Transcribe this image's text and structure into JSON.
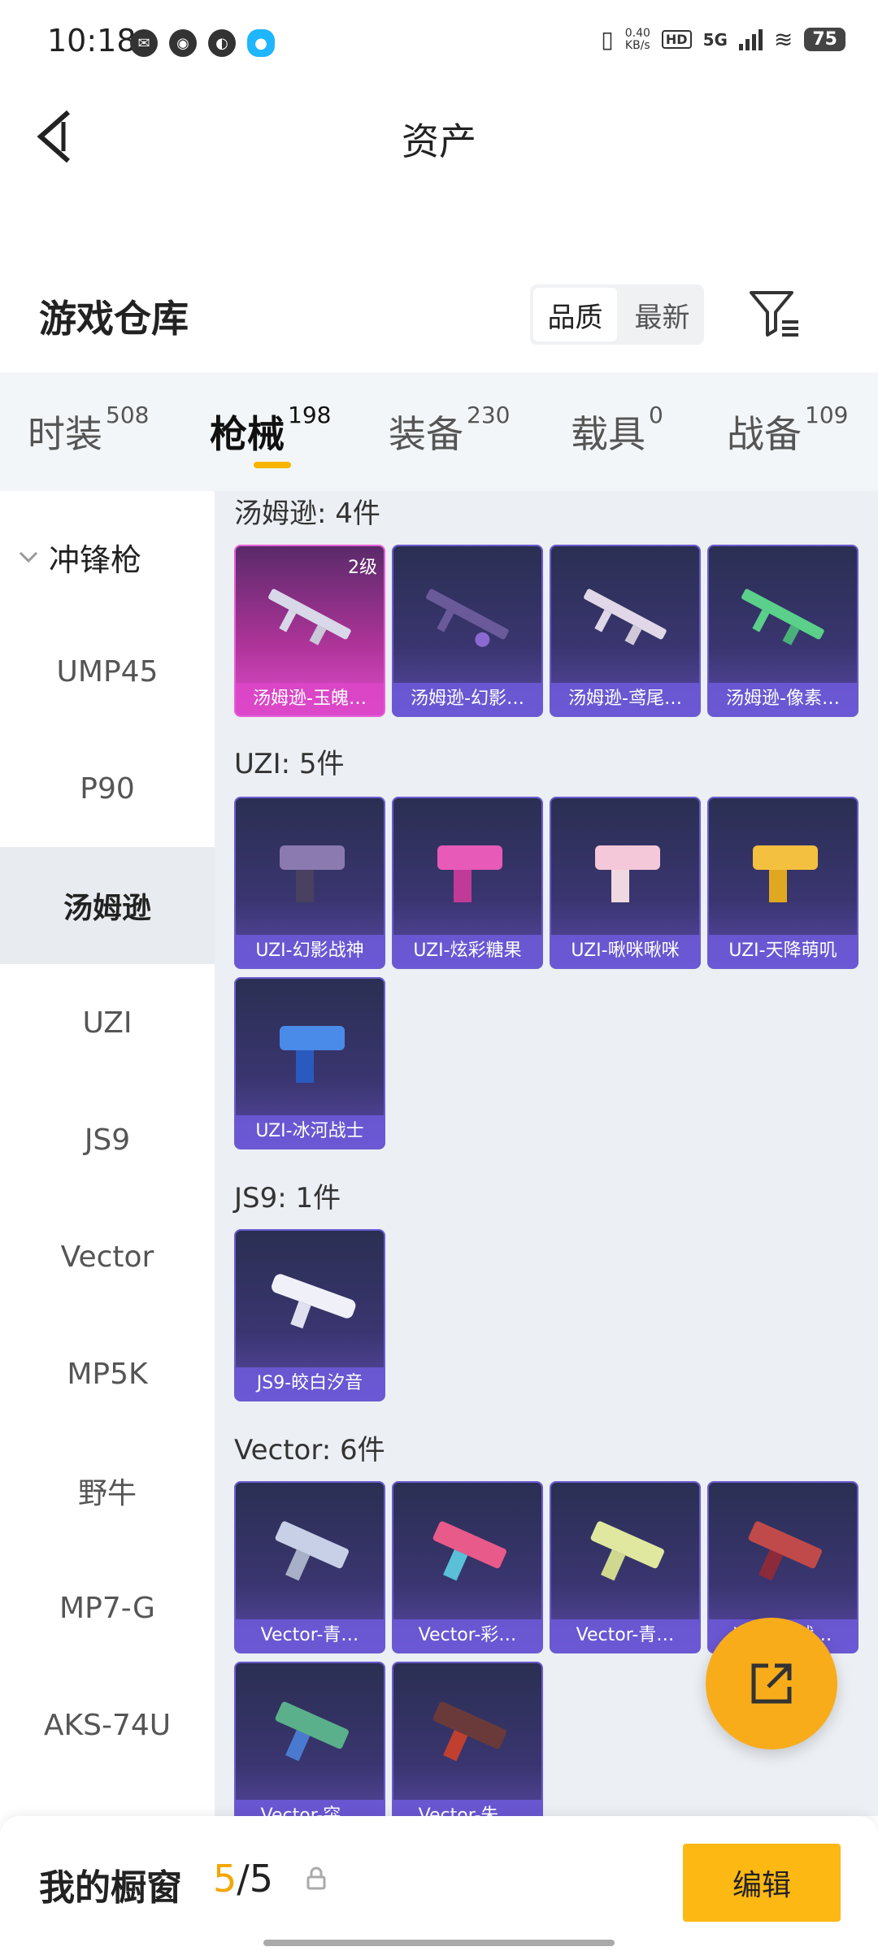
{
  "status_bar": {
    "time": "10:18",
    "net_speed_value": "0.40",
    "net_speed_unit": "KB/s",
    "hd": "HD",
    "network": "5G",
    "battery": "75"
  },
  "header": {
    "title": "资产"
  },
  "warehouse": {
    "title": "游戏仓库",
    "sort_options": [
      "品质",
      "最新"
    ],
    "sort_selected": "品质"
  },
  "tabs": [
    {
      "label": "时装",
      "count": "508"
    },
    {
      "label": "枪械",
      "count": "198"
    },
    {
      "label": "装备",
      "count": "230"
    },
    {
      "label": "载具",
      "count": "0"
    },
    {
      "label": "战备",
      "count": "109"
    }
  ],
  "sidebar": {
    "group": "冲锋枪",
    "items": [
      "UMP45",
      "P90",
      "汤姆逊",
      "UZI",
      "JS9",
      "Vector",
      "MP5K",
      "野牛",
      "MP7-G",
      "AKS-74U"
    ]
  },
  "sections": [
    {
      "title": "汤姆逊: 4件",
      "cards": [
        {
          "name": "汤姆逊-玉魄…",
          "level": "2级",
          "style": "pink"
        },
        {
          "name": "汤姆逊-幻影…",
          "style": "purple"
        },
        {
          "name": "汤姆逊-鸢尾…",
          "style": "purple"
        },
        {
          "name": "汤姆逊-像素…",
          "style": "purple"
        }
      ]
    },
    {
      "title": "UZI: 5件",
      "cards": [
        {
          "name": "UZI-幻影战神",
          "style": "purple"
        },
        {
          "name": "UZI-炫彩糖果",
          "style": "purple"
        },
        {
          "name": "UZI-啾咪啾咪",
          "style": "purple"
        },
        {
          "name": "UZI-天降萌叽",
          "style": "purple"
        },
        {
          "name": "UZI-冰河战士",
          "style": "purple"
        }
      ]
    },
    {
      "title": "JS9: 1件",
      "cards": [
        {
          "name": "JS9-皎白汐音",
          "style": "purple"
        }
      ]
    },
    {
      "title": "Vector: 6件",
      "cards": [
        {
          "name": "Vector-青…",
          "style": "purple"
        },
        {
          "name": "Vector-彩…",
          "style": "purple"
        },
        {
          "name": "Vector-青…",
          "style": "purple"
        },
        {
          "name": "Vector-战…",
          "style": "purple"
        },
        {
          "name": "Vector-突…",
          "style": "purple"
        },
        {
          "name": "Vector-朱…",
          "style": "purple"
        }
      ]
    }
  ],
  "bottom_bar": {
    "label": "我的橱窗",
    "current": "5",
    "separator": "/",
    "total": "5",
    "edit_label": "编辑"
  },
  "icons": {
    "back": "back-arrow-icon",
    "filter": "filter-icon",
    "share": "share-external-icon",
    "lock": "lock-icon"
  },
  "colors": {
    "accent": "#fdb813",
    "card_purple": "#3a3570",
    "card_pink": "#c038a8",
    "content_bg": "#eceff3"
  }
}
